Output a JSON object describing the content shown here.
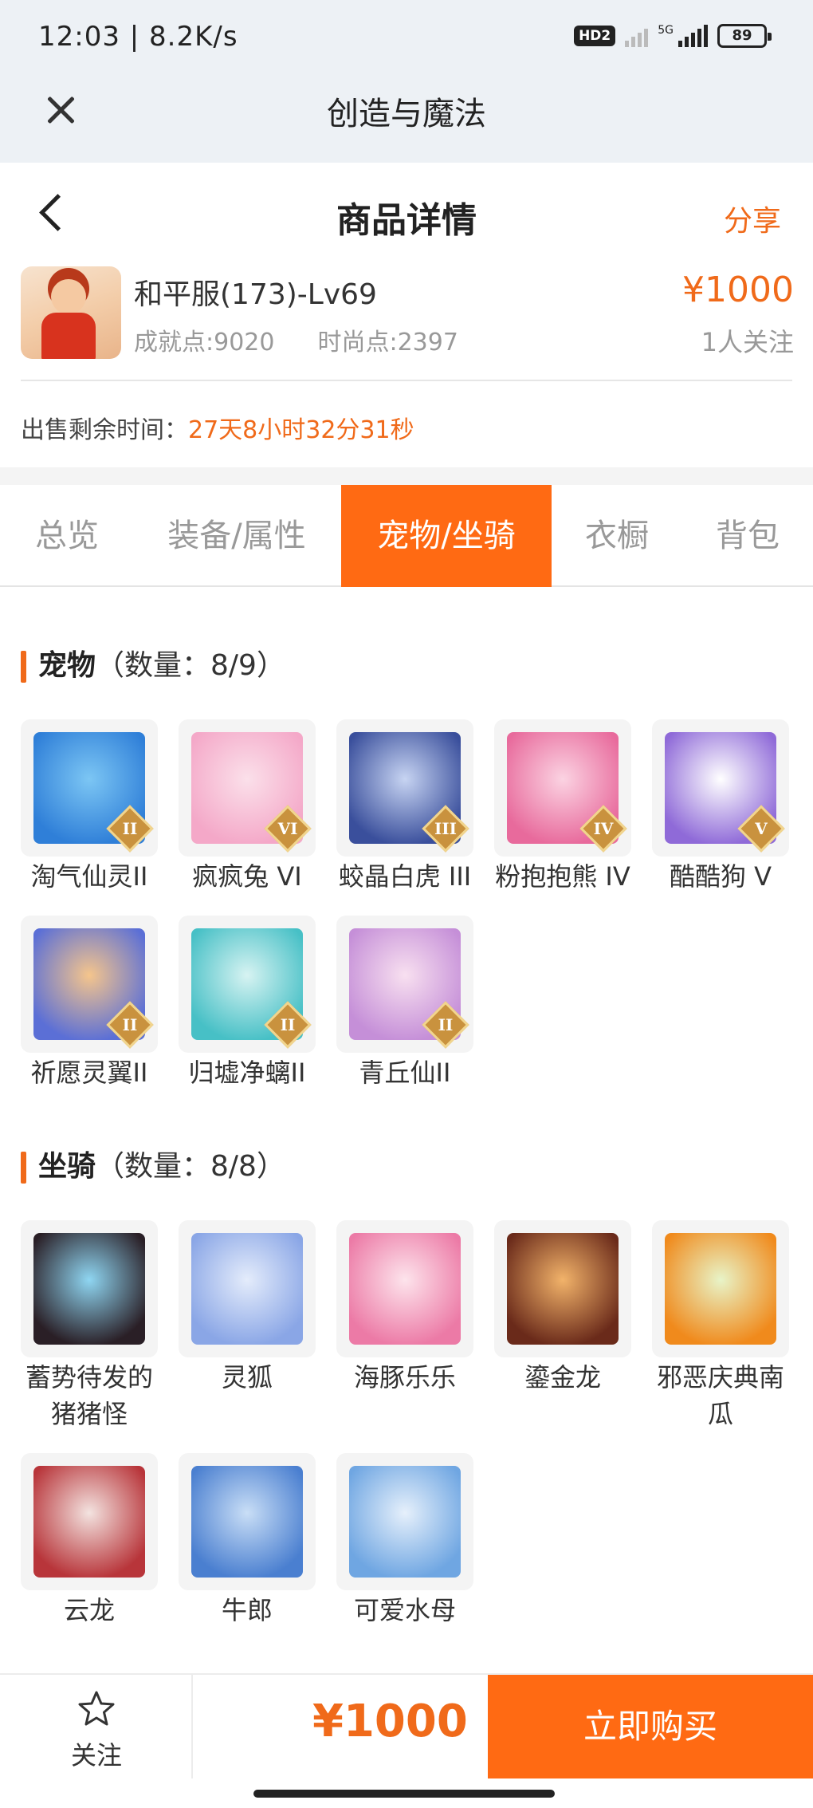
{
  "status_bar": {
    "time": "12:03 | 8.2K/s",
    "hd_badge": "HD2",
    "network": "5G",
    "battery": "89"
  },
  "app_bar": {
    "title": "创造与魔法",
    "close_icon": "close-icon"
  },
  "header": {
    "title": "商品详情",
    "share_label": "分享",
    "back_icon": "chevron-left-icon"
  },
  "product": {
    "server_name": "和平服(173)-Lv69",
    "achievement": "成就点:9020",
    "fashion": "时尚点:2397",
    "price": "¥1000",
    "followers": "1人关注"
  },
  "sale": {
    "label": "出售剩余时间：",
    "remaining": "27天8小时32分31秒"
  },
  "tabs": [
    {
      "label": "总览",
      "active": false
    },
    {
      "label": "装备/属性",
      "active": false
    },
    {
      "label": "宠物/坐骑",
      "active": true
    },
    {
      "label": "衣橱",
      "active": false
    },
    {
      "label": "背包",
      "active": false
    }
  ],
  "pets": {
    "title": "宠物",
    "count": "（数量：8/9）",
    "items": [
      {
        "name": "淘气仙灵II",
        "roman": "II",
        "colors": [
          "#7cc6f4",
          "#2f7fd8"
        ]
      },
      {
        "name": "疯疯兔 VI",
        "roman": "VI",
        "colors": [
          "#fbe0ea",
          "#f4a8c8"
        ]
      },
      {
        "name": "蛟晶白虎 III",
        "roman": "III",
        "colors": [
          "#c7d4f2",
          "#3a4f9c"
        ]
      },
      {
        "name": "粉抱抱熊 IV",
        "roman": "IV",
        "colors": [
          "#fbd3e2",
          "#e86a9c"
        ]
      },
      {
        "name": "酷酷狗 V",
        "roman": "V",
        "colors": [
          "#ffffff",
          "#8f6ad8"
        ]
      },
      {
        "name": "祈愿灵翼II",
        "roman": "II",
        "colors": [
          "#f5c58c",
          "#5b6fd6"
        ]
      },
      {
        "name": "归墟净螭II",
        "roman": "II",
        "colors": [
          "#d7f3f2",
          "#47c0c6"
        ]
      },
      {
        "name": "青丘仙II",
        "roman": "II",
        "colors": [
          "#f8e0f0",
          "#c58fd8"
        ]
      }
    ]
  },
  "mounts": {
    "title": "坐骑",
    "count": "（数量：8/8）",
    "items": [
      {
        "name": "蓄势待发的猪猪怪",
        "colors": [
          "#8fd6f2",
          "#2a1f26"
        ]
      },
      {
        "name": "灵狐",
        "colors": [
          "#e4ecfb",
          "#8aa6e6"
        ]
      },
      {
        "name": "海豚乐乐",
        "colors": [
          "#fde4ec",
          "#ec7aa6"
        ]
      },
      {
        "name": "鎏金龙",
        "colors": [
          "#f2b36a",
          "#6a2a1a"
        ]
      },
      {
        "name": "邪恶庆典南瓜",
        "colors": [
          "#e8f4c8",
          "#f08a1c"
        ]
      },
      {
        "name": "云龙",
        "colors": [
          "#f3e3e0",
          "#b8353a"
        ]
      },
      {
        "name": "牛郎",
        "colors": [
          "#c9def6",
          "#4a7fd0"
        ]
      },
      {
        "name": "可爱水母",
        "colors": [
          "#e6f0fb",
          "#6fa6e2"
        ]
      }
    ]
  },
  "bottom_bar": {
    "follow_label": "关注",
    "price": "¥1000",
    "buy_label": "立即购买"
  }
}
